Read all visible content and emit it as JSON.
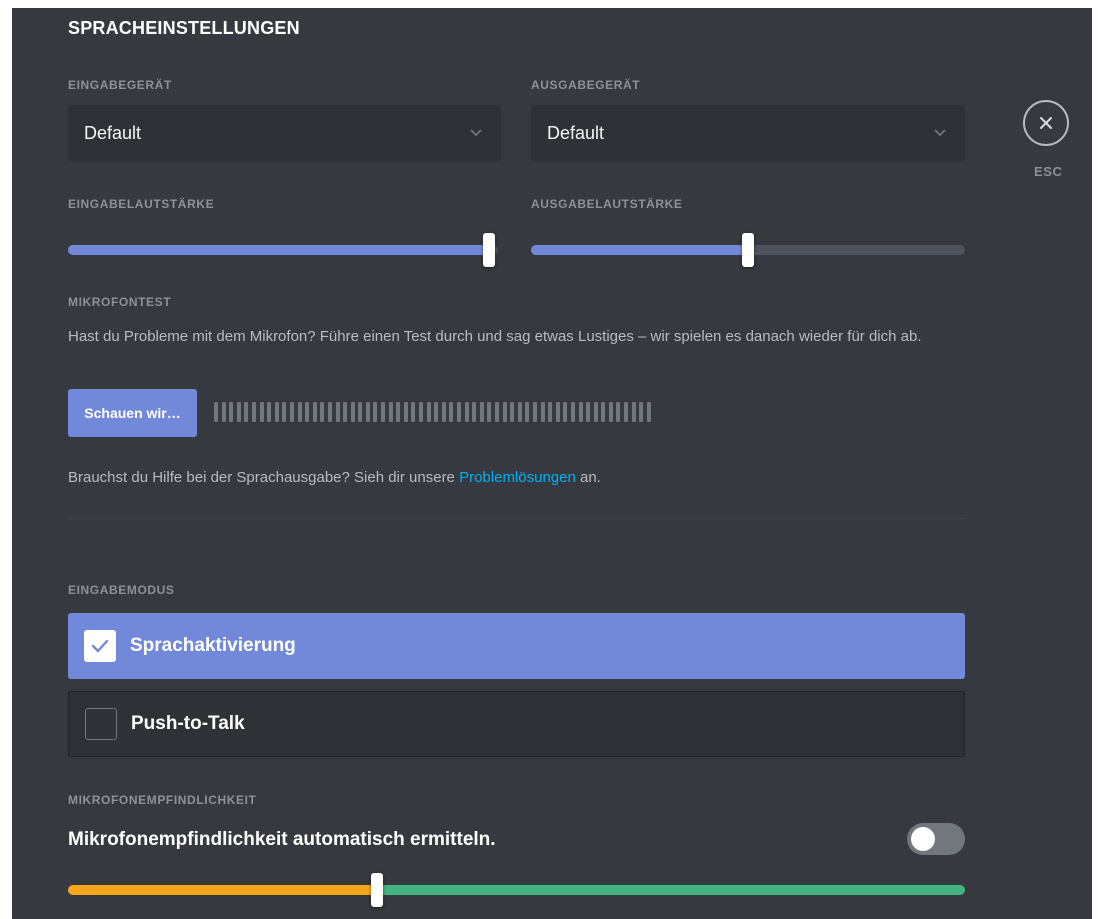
{
  "title": "SPRACHEINSTELLUNGEN",
  "close": {
    "label": "ESC",
    "icon": "close-icon"
  },
  "input_device": {
    "label": "EINGABEGERÄT",
    "value": "Default",
    "icon": "chevron-down-icon"
  },
  "output_device": {
    "label": "AUSGABEGERÄT",
    "value": "Default",
    "icon": "chevron-down-icon"
  },
  "input_volume": {
    "label": "EINGABELAUTSTÄRKE",
    "level": 0.98
  },
  "output_volume": {
    "label": "AUSGABELAUTSTÄRKE",
    "level": 0.5
  },
  "mic_test": {
    "label": "MIKROFONTEST",
    "description": "Hast du Probleme mit dem Mikrofon? Führe einen Test durch und sag etwas Lustiges – wir spielen es danach wieder für dich ab.",
    "button": "Schauen wir…",
    "meter_bars": 58
  },
  "help": {
    "prefix": "Brauchst du Hilfe bei der Sprachausgabe? Sieh dir unsere ",
    "link": "Problemlösungen",
    "suffix": " an."
  },
  "input_mode": {
    "label": "EINGABEMODUS",
    "options": [
      {
        "label": "Sprachaktivierung",
        "checked": true
      },
      {
        "label": "Push-to-Talk",
        "checked": false
      }
    ]
  },
  "sensitivity": {
    "label": "MIKROFONEMPFINDLICHKEIT",
    "auto_label": "Mikrofonempfindlichkeit automatisch ermitteln.",
    "auto_enabled": false,
    "threshold": 0.345
  },
  "colors": {
    "accent": "#7289da",
    "sensitivity_low": "#faa61a",
    "sensitivity_high": "#43b581",
    "link": "#00b0f4"
  }
}
